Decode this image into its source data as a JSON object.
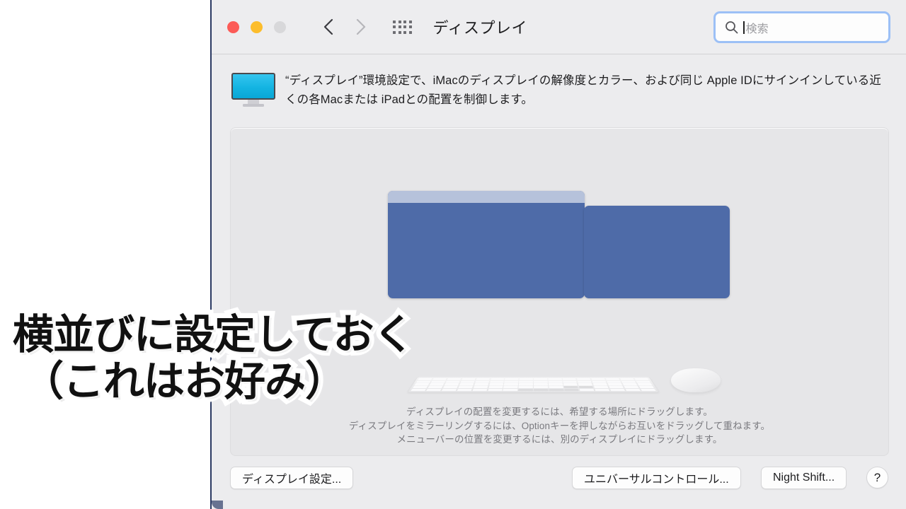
{
  "window": {
    "title": "ディスプレイ",
    "traffic_lights": [
      {
        "name": "close",
        "color": "#fc5b57"
      },
      {
        "name": "minimize",
        "color": "#fcbd2c"
      },
      {
        "name": "zoom",
        "color": "#d8d8da"
      }
    ],
    "nav": {
      "back_icon": "chevron-left-icon",
      "forward_icon": "chevron-right-icon",
      "grid_icon": "show-all-grid-icon"
    }
  },
  "search": {
    "placeholder": "検索",
    "value": "",
    "icon": "search-icon",
    "focused": true,
    "focus_ring_color": "#9cc0f6"
  },
  "description": {
    "icon": "display-monitor-icon",
    "text": "“ディスプレイ”環境設定で、iMacのディスプレイの解像度とカラー、および同じ Apple IDにサインインしている近くの各Macまたは iPadとの配置を制御します。"
  },
  "arrangement": {
    "panel_bg": "#e6e6e8",
    "displays": [
      {
        "name": "primary-display",
        "has_menu_bar": true,
        "color": "#4e6ba8",
        "menu_bar_color": "#b6c2db"
      },
      {
        "name": "secondary-display",
        "has_menu_bar": false,
        "color": "#4e6ba8"
      }
    ],
    "peripherals": [
      "magic-keyboard",
      "magic-mouse"
    ],
    "hints": [
      "ディスプレイの配置を変更するには、希望する場所にドラッグします。",
      "ディスプレイをミラーリングするには、Optionキーを押しながらお互いをドラッグして重ねます。",
      "メニューバーの位置を変更するには、別のディスプレイにドラッグします。"
    ]
  },
  "buttons": {
    "display_settings": "ディスプレイ設定...",
    "universal_control": "ユニバーサルコントロール...",
    "night_shift": "Night Shift...",
    "help": "?"
  },
  "caption": {
    "line1": "横並びに設定しておく",
    "line2": "（これはお好み）",
    "text_color": "#111111",
    "outline_color": "#ffffff"
  }
}
